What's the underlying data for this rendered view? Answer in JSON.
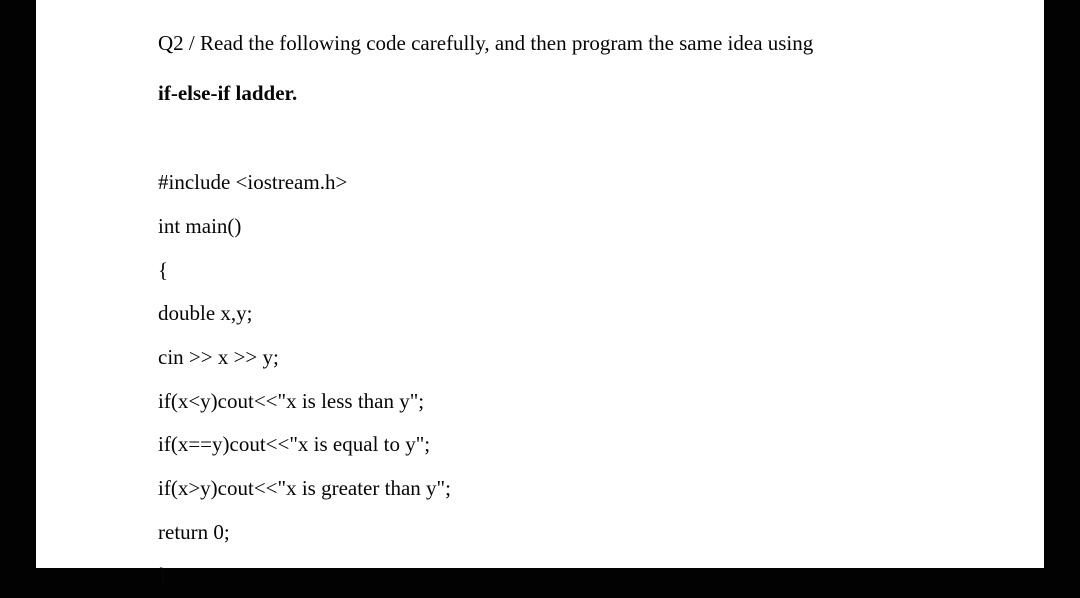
{
  "question": {
    "prefix": "Q2 / ",
    "text": "Read the following code carefully, and then program the same idea using",
    "bold": "if-else-if ladder."
  },
  "code": {
    "lines": [
      "#include <iostream.h>",
      "int main()",
      "{",
      "double x,y;",
      "cin >> x >> y;",
      "if(x<y)cout<<\"x is less than y\";",
      "if(x==y)cout<<\"x is equal to y\";",
      "if(x>y)cout<<\"x is greater than y\";",
      "return 0;",
      "}"
    ]
  }
}
